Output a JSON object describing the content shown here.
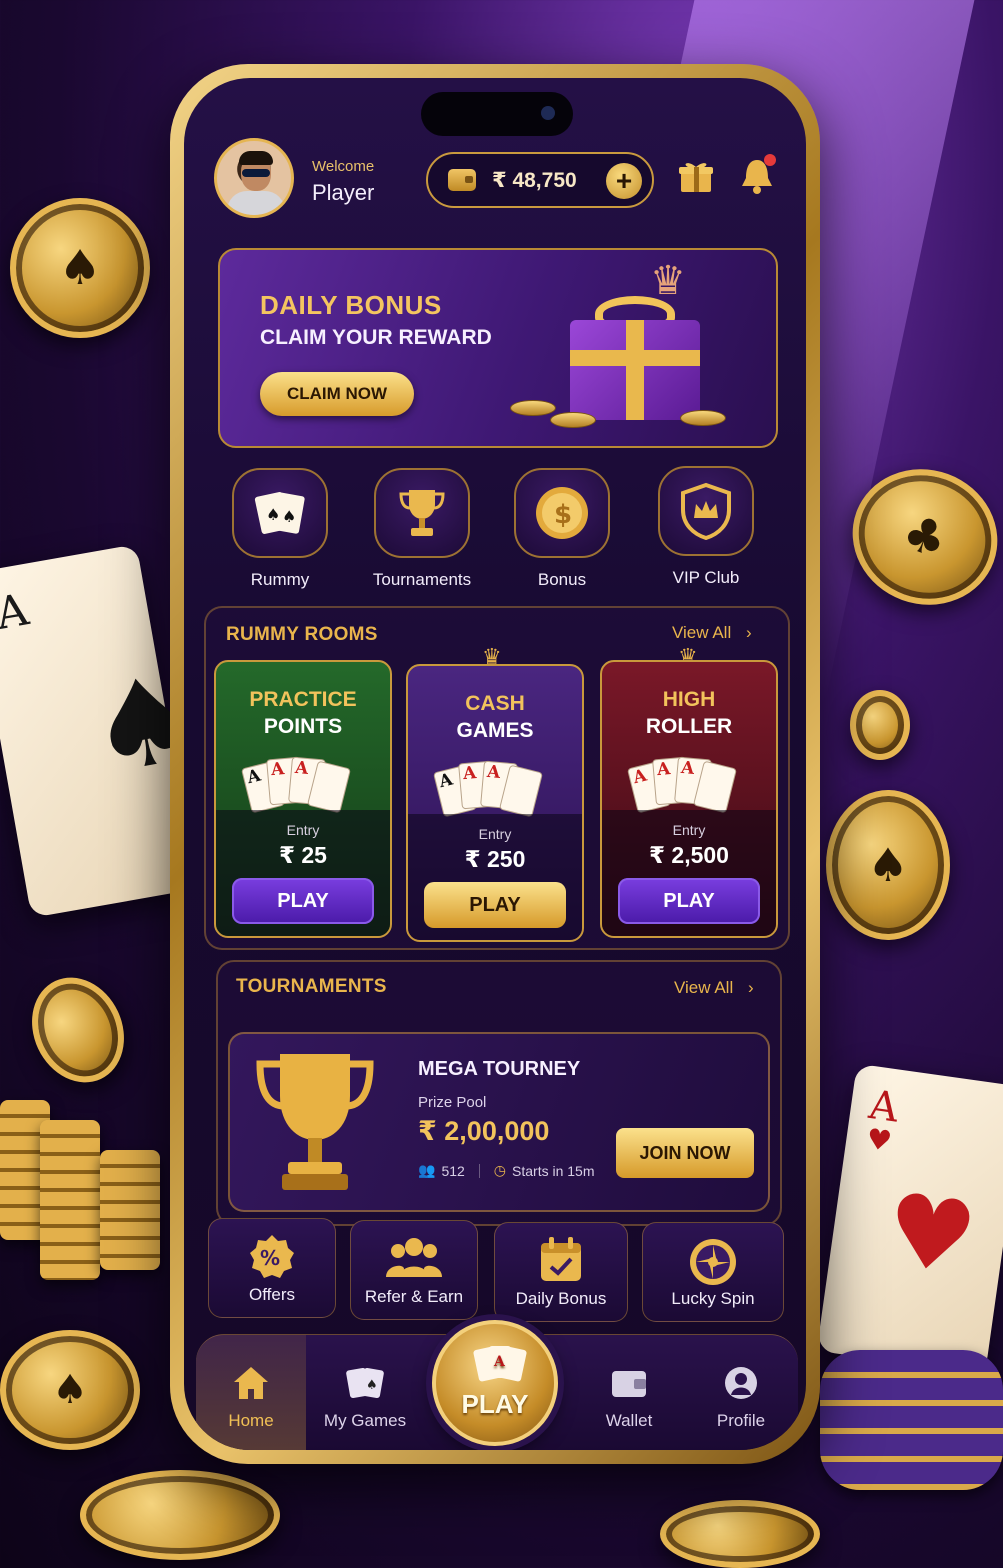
{
  "header": {
    "welcome": "Welcome",
    "player_name": "Player",
    "balance": "₹ 48,750"
  },
  "banner": {
    "title": "DAILY BONUS",
    "subtitle": "CLAIM YOUR REWARD",
    "cta": "CLAIM NOW"
  },
  "categories": [
    {
      "label": "Rummy",
      "icon": "cards-icon"
    },
    {
      "label": "Tournaments",
      "icon": "trophy-icon"
    },
    {
      "label": "Bonus",
      "icon": "coin-icon"
    },
    {
      "label": "VIP Club",
      "icon": "crown-shield-icon"
    }
  ],
  "rummy_rooms": {
    "title": "RUMMY ROOMS",
    "view_all": "View All",
    "rooms": [
      {
        "name_line1": "PRACTICE",
        "name_line2": "POINTS",
        "entry_label": "Entry",
        "entry": "₹ 25",
        "play": "PLAY",
        "accent": "#1f5a24"
      },
      {
        "name_line1": "CASH",
        "name_line2": "GAMES",
        "entry_label": "Entry",
        "entry": "₹ 250",
        "play": "PLAY",
        "accent": "#3d1c6b"
      },
      {
        "name_line1": "HIGH",
        "name_line2": "ROLLER",
        "entry_label": "Entry",
        "entry": "₹ 2,500",
        "play": "PLAY",
        "accent": "#6b1420"
      }
    ]
  },
  "tournaments": {
    "title": "TOURNAMENTS",
    "view_all": "View All",
    "featured": {
      "name": "MEGA TOURNEY",
      "prize_label": "Prize Pool",
      "prize": "₹ 2,00,000",
      "players": "512",
      "starts": "Starts in 15m",
      "cta": "JOIN NOW"
    }
  },
  "quick_tiles": [
    {
      "label": "Offers",
      "icon": "percent-badge-icon"
    },
    {
      "label": "Refer & Earn",
      "icon": "users-icon"
    },
    {
      "label": "Daily Bonus",
      "icon": "calendar-check-icon"
    },
    {
      "label": "Lucky Spin",
      "icon": "spin-wheel-icon"
    }
  ],
  "nav": {
    "home": "Home",
    "my_games": "My Games",
    "play": "PLAY",
    "wallet": "Wallet",
    "profile": "Profile"
  },
  "colors": {
    "gold": "#e9b54c",
    "purple": "#3e1873",
    "button_purple": "#5a28c0"
  }
}
